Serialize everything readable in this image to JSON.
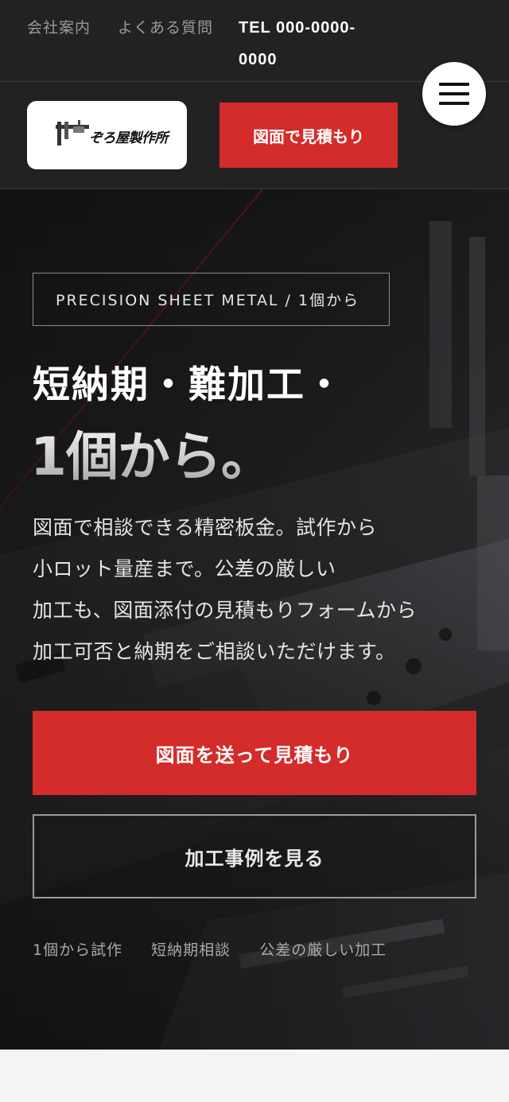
{
  "topbar": {
    "company_label": "会社案内",
    "faq_label": "よくある質問",
    "tel_label": "TEL 000-0000-0000"
  },
  "header": {
    "logo_text": "ぞろ屋製作所",
    "cta_label": "図面で見積もり",
    "menu_icon": "hamburger-icon"
  },
  "hero": {
    "tag": "PRECISION SHEET METAL / 1個から",
    "headline_line1": "短納期・難加工・",
    "headline_line2": "1個から。",
    "lead_lines": [
      "図面で相談できる精密板金。試作から",
      "小ロット量産まで。公差の厳しい",
      "加工も、図面添付の見積もりフォームから",
      "加工可否と納期をご相談いただけます。"
    ],
    "primary_cta": "図面を送って見積もり",
    "secondary_cta": "加工事例を見る",
    "features": [
      "1個から試作",
      "短納期相談",
      "公差の厳しい加工"
    ]
  },
  "colors": {
    "accent": "#d42b2b",
    "header_bg": "#222222",
    "hero_text": "#ffffff"
  }
}
